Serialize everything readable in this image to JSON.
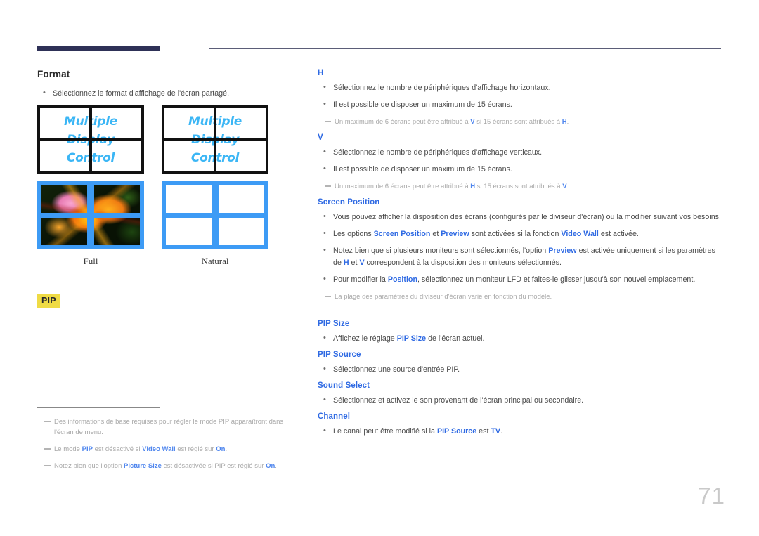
{
  "page": {
    "number": "71",
    "accent_blue": "#2f6ae3",
    "header_bar_color": "#2e3157",
    "badge_color": "#efdb45"
  },
  "left": {
    "format": {
      "title": "Format",
      "bullets": [
        "Sélectionnez le format d'affichage de l'écran partagé."
      ]
    },
    "diagram": {
      "wall_text": "Multiple\nDisplay\nControl",
      "captions": [
        "Full",
        "Natural"
      ],
      "tiles": [
        {
          "name": "full-wall-black",
          "type": "black-bezel",
          "has_text": true
        },
        {
          "name": "natural-wall-black",
          "type": "black-bezel",
          "has_text": true
        },
        {
          "name": "full-wall-photo",
          "type": "blue-bezel-photo",
          "has_text": false
        },
        {
          "name": "natural-wall-empty",
          "type": "blue-bezel-empty",
          "has_text": false
        }
      ]
    },
    "pip_badge": "PIP",
    "notes": [
      "Des informations de base requises pour régler le mode PIP apparaîtront dans l'écran de menu.",
      "Le mode PIP est désactivé si Video Wall est réglé sur On.",
      "Notez bien que l'option Picture Size est désactivée si PIP est réglé sur On."
    ]
  },
  "right": {
    "h": {
      "title": "H",
      "bullets": [
        "Sélectionnez le nombre de périphériques d'affichage horizontaux.",
        "Il est possible de disposer un maximum de 15 écrans."
      ],
      "note": "Un maximum de 6 écrans peut être attribué à V si 15 écrans sont attribués à H."
    },
    "v": {
      "title": "V",
      "bullets": [
        "Sélectionnez le nombre de périphériques d'affichage verticaux.",
        "Il est possible de disposer un maximum de 15 écrans."
      ],
      "note": "Un maximum de 6 écrans peut être attribué à H si 15 écrans sont attribués à V."
    },
    "screen_position": {
      "title": "Screen Position",
      "bullets": [
        "Vous pouvez afficher la disposition des écrans (configurés par le diviseur d'écran) ou la modifier suivant vos besoins.",
        "Les options Screen Position et Preview sont activées si la fonction Video Wall est activée.",
        "Notez bien que si plusieurs moniteurs sont sélectionnés, l'option Preview est activée uniquement si les paramètres de H et V correspondent à la disposition des moniteurs sélectionnés.",
        "Pour modifier la Position, sélectionnez un moniteur LFD et faites-le glisser jusqu'à son nouvel emplacement."
      ],
      "note": "La plage des paramètres du diviseur d'écran varie en fonction du modèle."
    },
    "pip_size": {
      "title": "PIP Size",
      "bullets": [
        "Affichez le réglage PIP Size de l'écran actuel."
      ]
    },
    "pip_source": {
      "title": "PIP Source",
      "bullets": [
        "Sélectionnez une source d'entrée PIP."
      ]
    },
    "sound_select": {
      "title": "Sound Select",
      "bullets": [
        "Sélectionnez et activez le son provenant de l'écran principal ou secondaire."
      ]
    },
    "channel": {
      "title": "Channel",
      "bullets": [
        "Le canal peut être modifié si la PIP Source est TV."
      ]
    }
  }
}
